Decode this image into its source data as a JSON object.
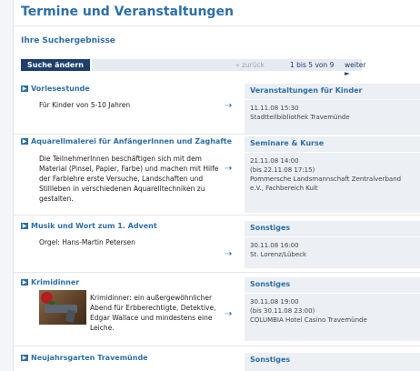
{
  "page": {
    "title": "Termine und Veranstaltungen",
    "subtitle": "Ihre Suchergebnisse"
  },
  "toolbar": {
    "search_label": "Suche ändern",
    "prev_label": "« zurück",
    "count_label": "1 bis 5 von 9",
    "next_label": "weiter ►"
  },
  "results": [
    {
      "title": "Vorlesestunde",
      "description": "Für Kinder von 5-10 Jahren",
      "category": "Veranstaltungen für Kinder",
      "info": "11.11.08 15:30\nStadtteilbibliothek Travemünde"
    },
    {
      "title": "Aquarellmalerei für AnfängerInnen und Zaghafte",
      "description": "Die TeilnehmerInnen beschäftigen sich mit dem Material (Pinsel, Papier, Farbe) und machen mit Hilfe der Farblehre erste Versuche, Landschaften und Stillleben in verschiedenen Aquarelltechniken zu gestalten.",
      "category": "Seminare & Kurse",
      "info": "21.11.08 14:00\n(bis 22.11.08 17:15)\nPommersche Landsmannschaft Zentralverband e.V., Fachbereich Kult"
    },
    {
      "title": "Musik und Wort zum 1. Advent",
      "description": "Orgel: Hans-Martin Petersen",
      "category": "Sonstiges",
      "info": "30.11.08 16:00\nSt. Lorenz/Lübeck"
    },
    {
      "title": "Krimidinner",
      "description": "Krimidinner: ein außergewöhnlicher Abend für Erbberechtigte, Detektive, Edgar Wallace und mindestens eine Leiche.",
      "category": "Sonstiges",
      "info": "30.11.08 19:00\n(bis 30.11.08 23:00)\nCOLUMBIA Hotel Casino Travemünde"
    },
    {
      "title": "Neujahrsgarten Travemünde",
      "description": "",
      "category": "Sonstiges",
      "info": ""
    }
  ],
  "icons": {
    "arrow": "arrow-right-icon",
    "link": "external-link-icon"
  }
}
